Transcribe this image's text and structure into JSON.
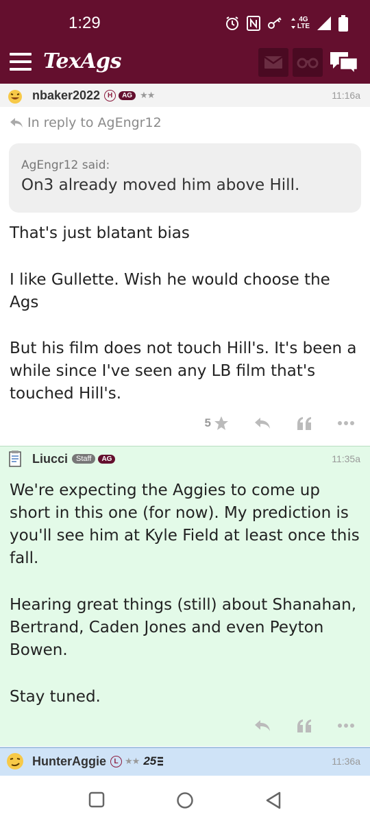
{
  "status_bar": {
    "time": "1:29",
    "network_top": "4G",
    "network_bottom": "LTE"
  },
  "header": {
    "logo_text": "TexAgs",
    "icons": [
      "menu-icon",
      "mail-icon",
      "binoculars-icon",
      "chat-icon"
    ]
  },
  "posts": [
    {
      "username": "nbaker2022",
      "badge_h": "H",
      "badge_ag": "AG",
      "stars": "★★",
      "time": "11:16a",
      "reply_to": "In reply to AgEngr12",
      "quote_author": "AgEngr12 said:",
      "quote_text": "On3 already moved him above Hill.",
      "body": [
        "That's just blatant bias",
        "I like Gullette. Wish he would choose the Ags",
        "But his film does not touch Hill's. It's been a while since I've seen any LB film that's touched Hill's."
      ],
      "star_count": "5"
    },
    {
      "username": "Liucci",
      "badge_staff": "Staff",
      "badge_ag": "AG",
      "time": "11:35a",
      "body": [
        "We're expecting the Aggies to come up short in this one (for now). My prediction is you'll see him at Kyle Field at least once this fall.",
        "Hearing great things (still) about Shanahan, Bertrand, Caden Jones and even Peyton Bowen.",
        "Stay tuned."
      ]
    },
    {
      "username": "HunterAggie",
      "badge_l": "L",
      "stars": "★★",
      "rank": "25",
      "time": "11:36a"
    }
  ],
  "colors": {
    "maroon": "#640f2e",
    "staff_bg": "#e3fae8",
    "next_bg": "#cfe3f7"
  }
}
